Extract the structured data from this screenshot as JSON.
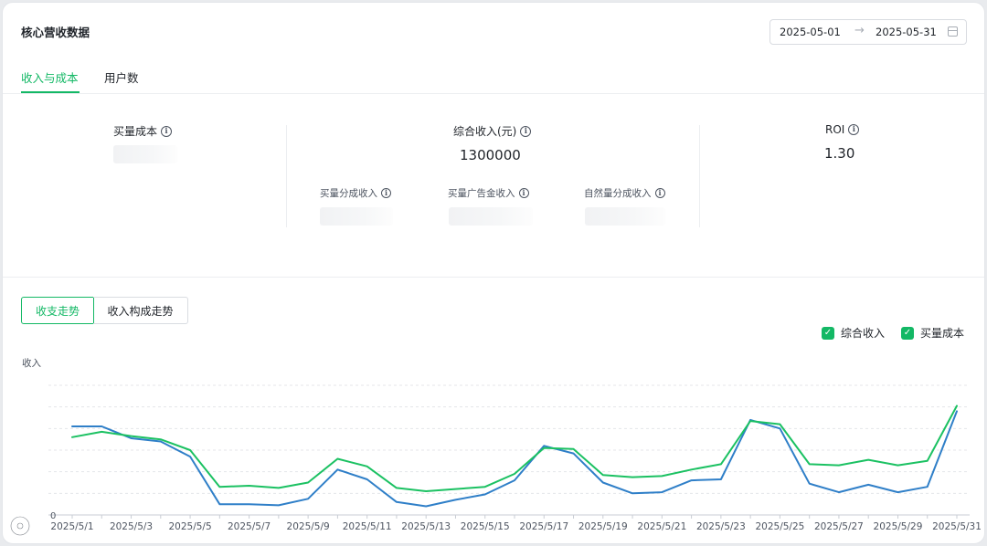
{
  "header": {
    "title": "核心营收数据",
    "date_start": "2025-05-01",
    "date_arrow": "→",
    "date_end": "2025-05-31"
  },
  "tabs": [
    {
      "label": "收入与成本",
      "active": true
    },
    {
      "label": "用户数",
      "active": false
    }
  ],
  "metrics": {
    "cost": {
      "label": "买量成本"
    },
    "revenue": {
      "label": "综合收入(元)",
      "value": "1300000",
      "sub": [
        {
          "label": "买量分成收入"
        },
        {
          "label": "买量广告金收入"
        },
        {
          "label": "自然量分成收入"
        }
      ]
    },
    "roi": {
      "label": "ROI",
      "value": "1.30"
    }
  },
  "segments": [
    {
      "label": "收支走势",
      "active": true
    },
    {
      "label": "收入构成走势",
      "active": false
    }
  ],
  "legend": [
    {
      "label": "综合收入",
      "checked": true,
      "color": "#1bc162"
    },
    {
      "label": "买量成本",
      "checked": true,
      "color": "#2f7fc8"
    }
  ],
  "chart_data": {
    "type": "line",
    "ylabel": "收入",
    "y_tick_labels": [
      "0"
    ],
    "x_tick_labels": [
      "2025/5/1",
      "2025/5/3",
      "2025/5/5",
      "2025/5/7",
      "2025/5/9",
      "2025/5/11",
      "2025/5/13",
      "2025/5/15",
      "2025/5/17",
      "2025/5/19",
      "2025/5/21",
      "2025/5/23",
      "2025/5/25",
      "2025/5/27",
      "2025/5/29",
      "2025/5/31"
    ],
    "x": [
      "2025/5/1",
      "2025/5/2",
      "2025/5/3",
      "2025/5/4",
      "2025/5/5",
      "2025/5/6",
      "2025/5/7",
      "2025/5/8",
      "2025/5/9",
      "2025/5/10",
      "2025/5/11",
      "2025/5/12",
      "2025/5/13",
      "2025/5/14",
      "2025/5/15",
      "2025/5/16",
      "2025/5/17",
      "2025/5/18",
      "2025/5/19",
      "2025/5/20",
      "2025/5/21",
      "2025/5/22",
      "2025/5/23",
      "2025/5/24",
      "2025/5/25",
      "2025/5/26",
      "2025/5/27",
      "2025/5/28",
      "2025/5/29",
      "2025/5/30",
      "2025/5/31"
    ],
    "series": [
      {
        "name": "综合收入",
        "color": "#1bc162",
        "values": [
          72,
          77,
          73,
          70,
          60,
          26,
          27,
          25,
          30,
          52,
          45,
          25,
          22,
          24,
          26,
          38,
          62,
          61,
          37,
          35,
          36,
          42,
          47,
          87,
          84,
          47,
          46,
          51,
          46,
          50,
          101
        ]
      },
      {
        "name": "买量成本",
        "color": "#2f7fc8",
        "values": [
          82,
          82,
          71,
          68,
          54,
          10,
          10,
          9,
          15,
          42,
          33,
          12,
          8,
          14,
          19,
          32,
          64,
          57,
          30,
          20,
          21,
          32,
          33,
          88,
          80,
          29,
          21,
          28,
          21,
          26,
          96
        ]
      }
    ],
    "ylim": [
      0,
      120
    ],
    "grid": true
  }
}
